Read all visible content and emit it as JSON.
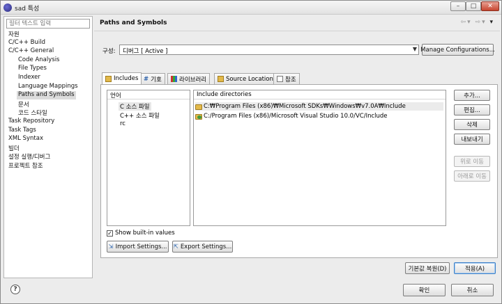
{
  "window": {
    "title": "sad 특성"
  },
  "filter": {
    "placeholder": "필터 텍스트 입력"
  },
  "nav": {
    "items": [
      {
        "label": "자원",
        "indent": 0
      },
      {
        "label": "C/C++ Build",
        "indent": 0
      },
      {
        "label": "C/C++ General",
        "indent": 0
      },
      {
        "label": "Code Analysis",
        "indent": 1
      },
      {
        "label": "File Types",
        "indent": 1
      },
      {
        "label": "Indexer",
        "indent": 1
      },
      {
        "label": "Language Mappings",
        "indent": 1
      },
      {
        "label": "Paths and Symbols",
        "indent": 1,
        "selected": true
      },
      {
        "label": "문서",
        "indent": 1
      },
      {
        "label": "코드 스타일",
        "indent": 1
      },
      {
        "label": "Task Repository",
        "indent": 0
      },
      {
        "label": "Task Tags",
        "indent": 0
      },
      {
        "label": "XML Syntax",
        "indent": 0
      },
      {
        "label": "빌더",
        "indent": 0
      },
      {
        "label": "설정 실행/디버그",
        "indent": 0
      },
      {
        "label": "프로젝트 참조",
        "indent": 0
      }
    ]
  },
  "header": {
    "title": "Paths and Symbols"
  },
  "config": {
    "label": "구성:",
    "value": "디버그  [ Active ]",
    "manage_label": "Manage Configurations..."
  },
  "tabs": [
    {
      "label": "Includes",
      "icon": "includes-icon",
      "active": true
    },
    {
      "label": "기호",
      "icon": "hash-icon"
    },
    {
      "label": "라이브러리",
      "icon": "library-icon"
    },
    {
      "label": "Source Location",
      "icon": "source-folder-icon"
    },
    {
      "label": "참조",
      "icon": "reference-icon"
    }
  ],
  "languages": {
    "header": "언어",
    "items": [
      "C 소스 파일",
      "C++ 소스 파일",
      "rc"
    ]
  },
  "directories": {
    "header": "Include directories",
    "items": [
      "C:₩Program Files (x86)₩Microsoft SDKs₩Windows₩v7.0A₩Include",
      "C:/Program Files (x86)/Microsoft Visual Studio 10.0/VC/Include"
    ]
  },
  "side_buttons": {
    "add": "추가...",
    "edit": "편집...",
    "delete": "삭제",
    "export": "내보내기",
    "move_up": "위로 이동",
    "move_down": "아래로 이동"
  },
  "show_builtin": {
    "label": "Show built-in values",
    "checked": "✓"
  },
  "import_label": "Import Settings...",
  "export_label": "Export Settings...",
  "footer": {
    "restore_defaults": "기본값 복원(D)",
    "apply": "적용(A)",
    "ok": "확인",
    "cancel": "취소"
  }
}
